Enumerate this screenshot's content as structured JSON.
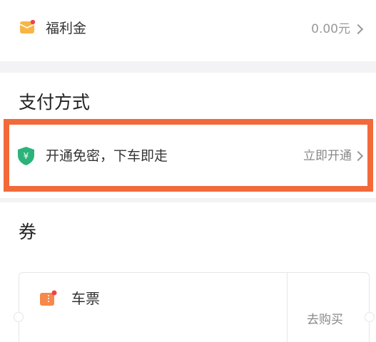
{
  "welfare": {
    "label": "福利金",
    "value": "0.00元",
    "icon": "red-envelope-icon",
    "icon_color": "#f7b547",
    "dot_color": "#f04444"
  },
  "payment": {
    "title": "支付方式",
    "option_text": "开通免密，下车即走",
    "action": "立即开通",
    "icon": "shield-yuan-icon",
    "shield_color": "#2bb37a",
    "highlight_color": "#f26a3a"
  },
  "coupons": {
    "title": "券",
    "ticket": {
      "label": "车票",
      "action": "去购买",
      "icon": "ticket-icon",
      "icon_color": "#f5884a"
    }
  }
}
